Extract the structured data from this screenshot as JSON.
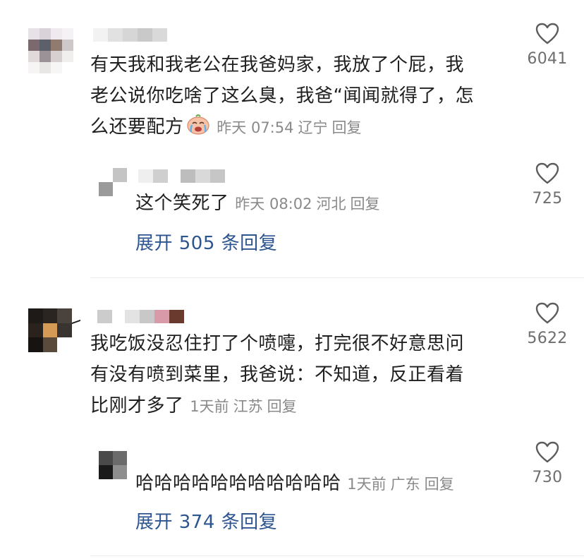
{
  "comments": [
    {
      "text_lines": [
        "有天我和我老公在我爸妈家，我放了个屁，我",
        "老公说你吃啥了这么臭，我爸“闻闻就得了，怎",
        "么还要配方"
      ],
      "emoji": "crying-face-emoji",
      "time": "昨天 07:54",
      "location": "辽宁",
      "reply_label": "回复",
      "likes": "6041",
      "reply": {
        "text": "这个笑死了",
        "time": "昨天 08:02",
        "location": "河北",
        "reply_label": "回复",
        "likes": "725"
      },
      "expand_label": "展开 505 条回复"
    },
    {
      "text_lines": [
        "我吃饭没忍住打了个喷嚏，打完很不好意思问",
        "有没有喷到菜里，我爸说：不知道，反正看着",
        "比刚才多了"
      ],
      "time": "1天前",
      "location": "江苏",
      "reply_label": "回复",
      "likes": "5622",
      "reply": {
        "text": "哈哈哈哈哈哈哈哈哈哈哈",
        "time": "1天前",
        "location": "广东",
        "reply_label": "回复",
        "likes": "730"
      },
      "expand_label": "展开 374 条回复"
    }
  ],
  "colors": {
    "link": "#2d5590",
    "meta": "#8a8a8a",
    "text": "#1f1f1f"
  }
}
